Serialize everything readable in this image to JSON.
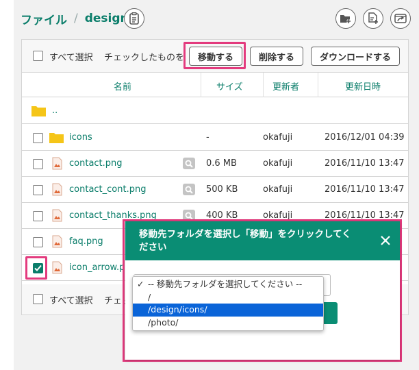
{
  "breadcrumb": {
    "root": "ファイル",
    "separator": "/",
    "current": "design"
  },
  "toolbar": {
    "select_all": "すべて選択",
    "checked_items": "チェックしたものを",
    "move_button": "移動する",
    "delete_button": "削除する",
    "download_button": "ダウンロードする"
  },
  "columns": {
    "name": "名前",
    "size": "サイズ",
    "updater": "更新者",
    "updated_at": "更新日時"
  },
  "rows": [
    {
      "type": "parent",
      "name": "..",
      "size": "",
      "user": "",
      "date": ""
    },
    {
      "type": "folder",
      "name": "icons",
      "size": "-",
      "user": "okafuji",
      "date": "2016/12/01 04:39"
    },
    {
      "type": "file",
      "name": "contact.png",
      "size": "0.6 MB",
      "user": "okafuji",
      "date": "2016/11/10 13:47"
    },
    {
      "type": "file",
      "name": "contact_cont.png",
      "size": "500 KB",
      "user": "okafuji",
      "date": "2016/11/10 13:47"
    },
    {
      "type": "file",
      "name": "contact_thanks.png",
      "size": "400 KB",
      "user": "okafuji",
      "date": "2016/11/10 13:47"
    },
    {
      "type": "file",
      "name": "faq.png",
      "size": "",
      "user": "",
      "date": ""
    },
    {
      "type": "file",
      "name": "icon_arrow.png",
      "size": "",
      "user": "",
      "date": "",
      "checked": true
    }
  ],
  "footer": {
    "select_all": "すべて選択",
    "checked_items": "チェック"
  },
  "modal": {
    "title": "移動先フォルダを選択し「移動」をクリックしてください",
    "options": [
      "-- 移動先フォルダを選択してください --",
      "/",
      "/design/icons/",
      "/photo/"
    ],
    "checkmark": "✓",
    "highlighted_option": "/design/icons/"
  },
  "colors": {
    "brand": "#0a7d6a",
    "modal_header": "#0a8d74",
    "highlight": "#e33b7e",
    "option_selected": "#0a64d8"
  },
  "icons": [
    "document-icon",
    "new-folder-icon",
    "new-file-icon",
    "upload-icon",
    "folder-icon",
    "image-file-icon",
    "zoom-icon",
    "close-icon",
    "checkmark-icon"
  ]
}
